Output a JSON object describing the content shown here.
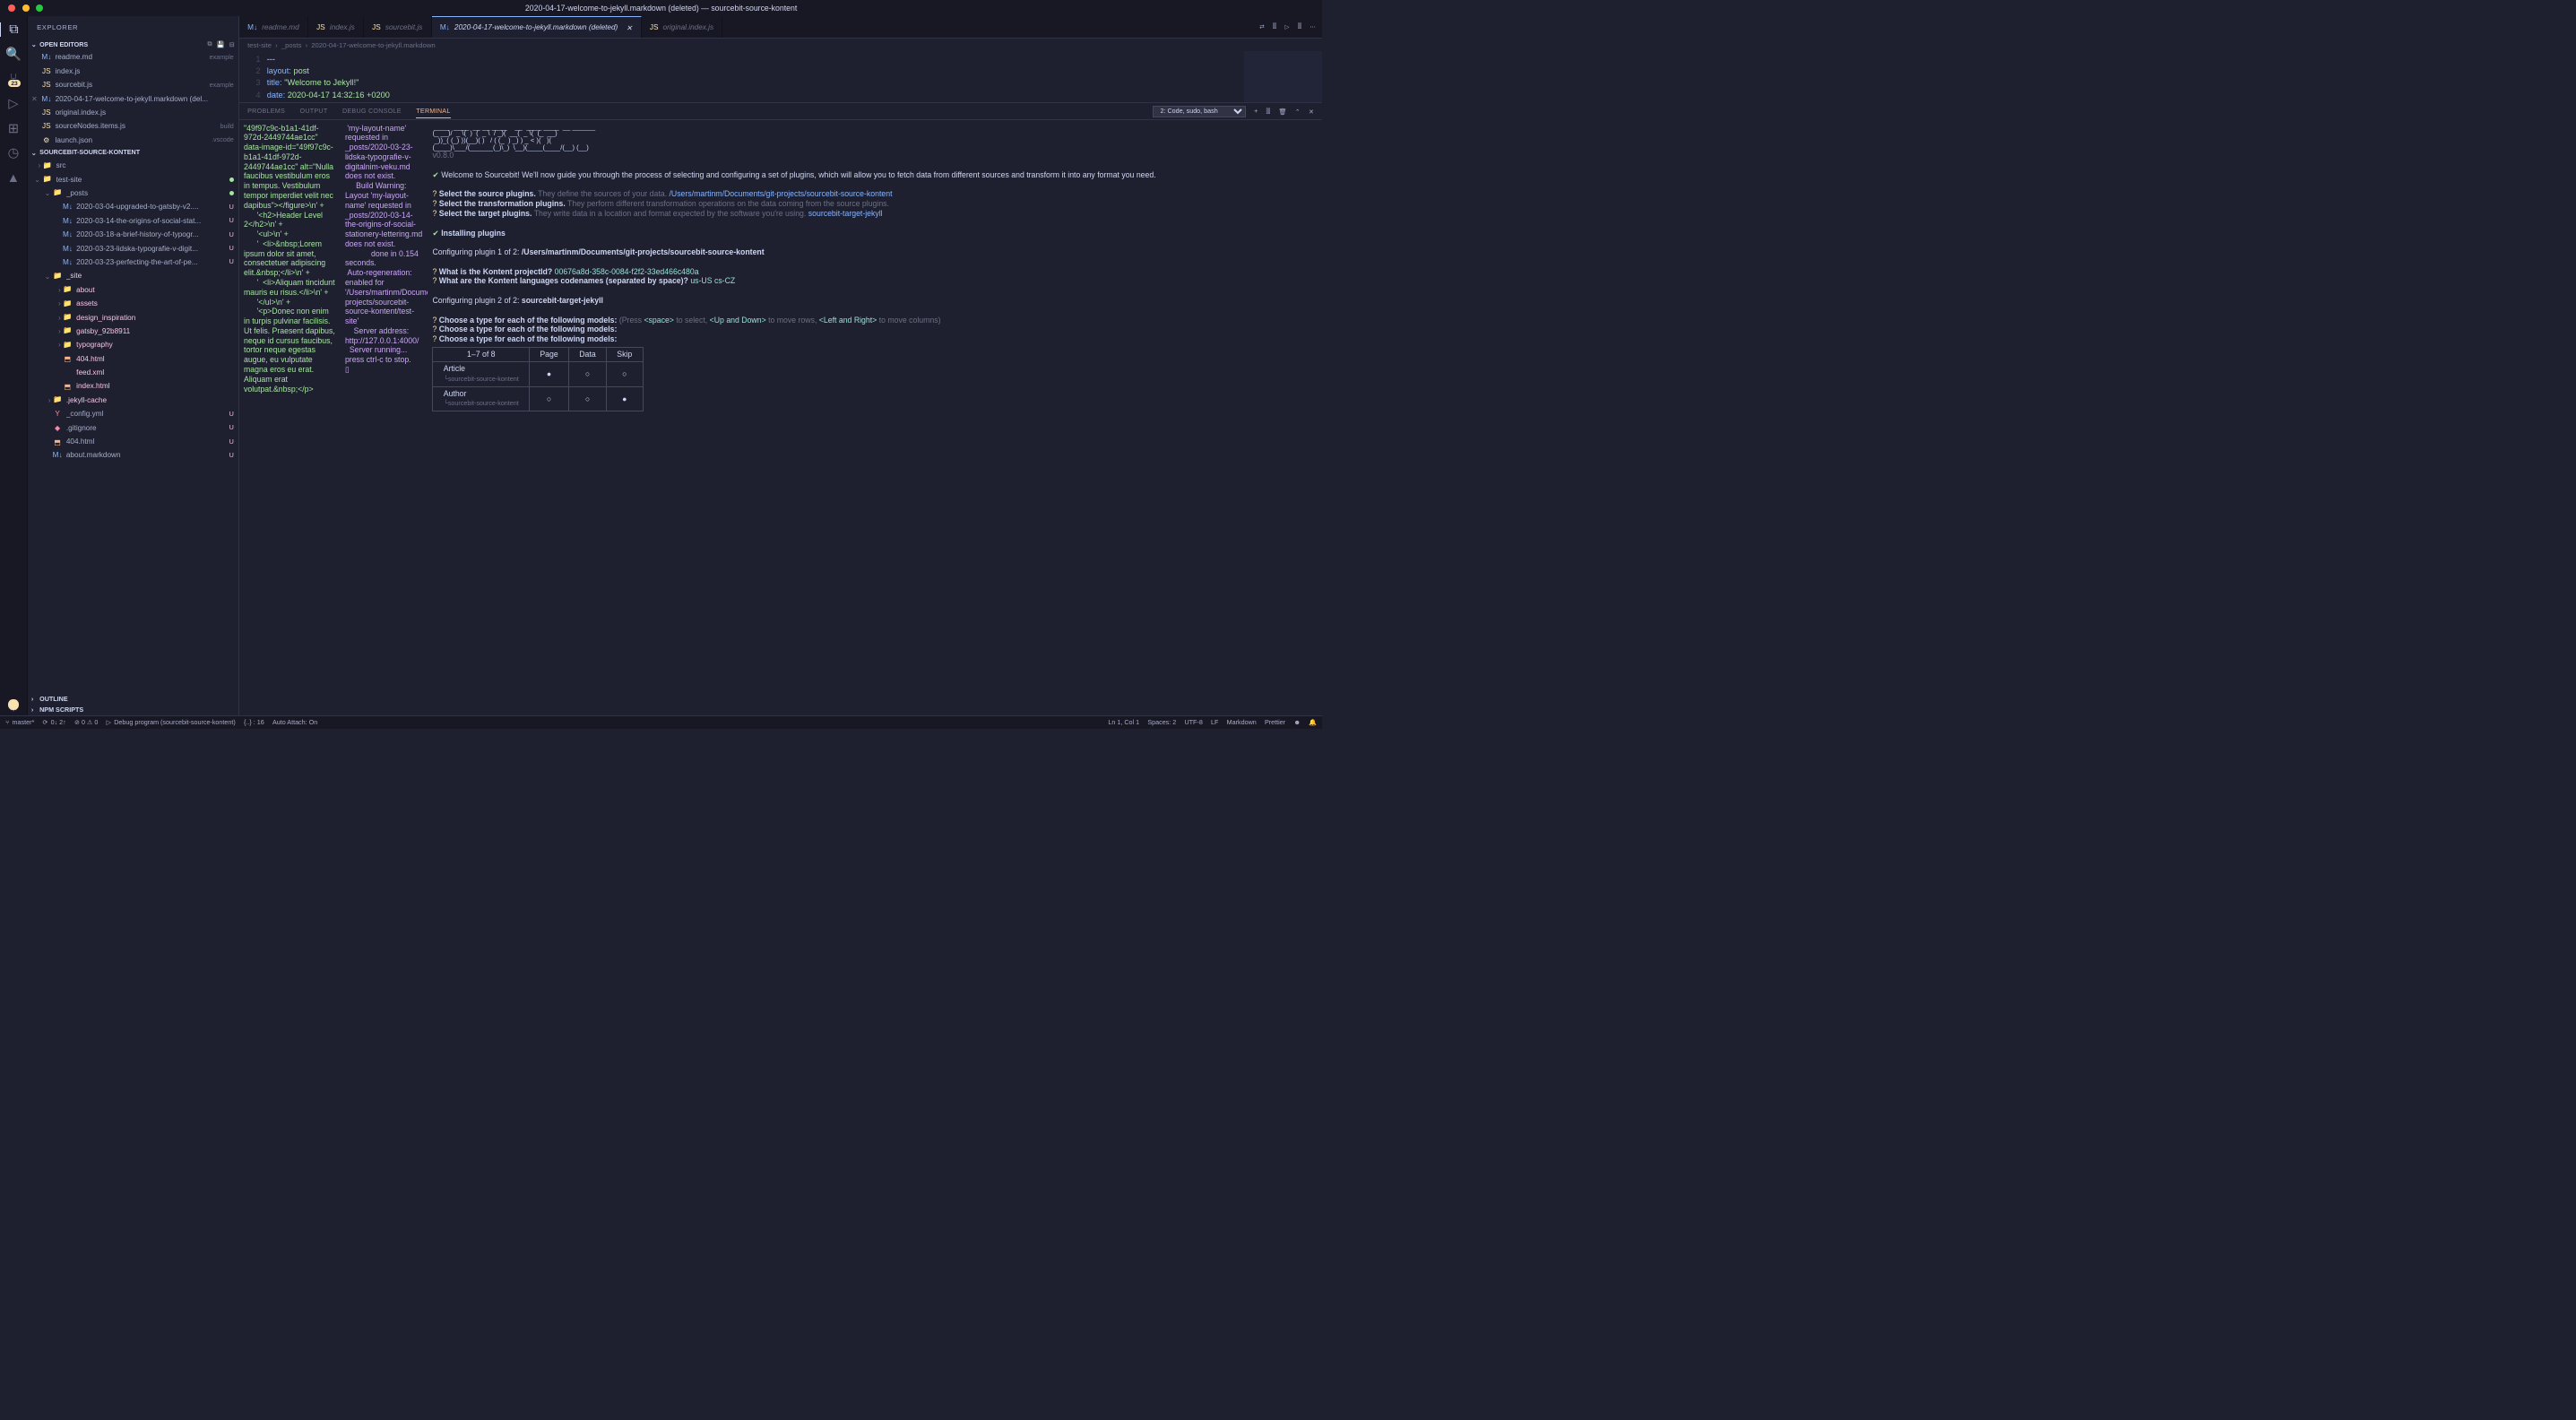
{
  "window_title": "2020-04-17-welcome-to-jekyll.markdown (deleted) — sourcebit-source-kontent",
  "explorer_label": "EXPLORER",
  "open_editors_label": "OPEN EDITORS",
  "open_editors": [
    {
      "icon": "M↓",
      "name": "readme.md",
      "desc": "example"
    },
    {
      "icon": "JS",
      "name": "index.js"
    },
    {
      "icon": "JS",
      "name": "sourcebit.js",
      "desc": "example"
    },
    {
      "icon": "M↓",
      "name": "2020-04-17-welcome-to-jekyll.markdown (del...",
      "close": true
    },
    {
      "icon": "JS",
      "name": "original.index.js"
    },
    {
      "icon": "JS",
      "name": "sourceNodes.items.js",
      "desc": "build"
    },
    {
      "icon": "⚙",
      "name": "launch.json",
      "desc": ".vscode"
    }
  ],
  "workspace_label": "SOURCEBIT-SOURCE-KONTENT",
  "tree": [
    {
      "indent": 1,
      "chev": "›",
      "ic": "📁",
      "label": "src",
      "cls": "folder"
    },
    {
      "indent": 1,
      "chev": "⌄",
      "ic": "📁",
      "label": "test-site",
      "cls": "folder",
      "dot": true
    },
    {
      "indent": 2,
      "chev": "⌄",
      "ic": "📁",
      "label": "_posts",
      "cls": "folder",
      "dot": true
    },
    {
      "indent": 3,
      "ic": "M↓",
      "label": "2020-03-04-upgraded-to-gatsby-v2....",
      "status": "U",
      "cls": "mdbadge"
    },
    {
      "indent": 3,
      "ic": "M↓",
      "label": "2020-03-14-the-origins-of-social-stat...",
      "status": "U",
      "cls": "mdbadge"
    },
    {
      "indent": 3,
      "ic": "M↓",
      "label": "2020-03-18-a-brief-history-of-typogr...",
      "status": "U",
      "cls": "mdbadge"
    },
    {
      "indent": 3,
      "ic": "M↓",
      "label": "2020-03-23-lidska-typografie-v-digit...",
      "status": "U",
      "cls": "mdbadge"
    },
    {
      "indent": 3,
      "ic": "M↓",
      "label": "2020-03-23-perfecting-the-art-of-pe...",
      "status": "U",
      "cls": "mdbadge"
    },
    {
      "indent": 2,
      "chev": "⌄",
      "ic": "📁",
      "label": "_site",
      "cls": "folder mod"
    },
    {
      "indent": 3,
      "chev": "›",
      "ic": "📁",
      "label": "about",
      "cls": "folder mod"
    },
    {
      "indent": 3,
      "chev": "›",
      "ic": "📁",
      "label": "assets",
      "cls": "folder mod"
    },
    {
      "indent": 3,
      "chev": "›",
      "ic": "📁",
      "label": "design_inspiration",
      "cls": "folder mod"
    },
    {
      "indent": 3,
      "chev": "›",
      "ic": "📁",
      "label": "gatsby_92b8911",
      "cls": "folder mod"
    },
    {
      "indent": 3,
      "chev": "›",
      "ic": "📁",
      "label": "typography",
      "cls": "folder mod"
    },
    {
      "indent": 3,
      "ic": "⬒",
      "label": "404.html",
      "cls": "html5 mod"
    },
    {
      "indent": 3,
      "ic": "</>",
      "label": "feed.xml",
      "cls": "fbadge mod"
    },
    {
      "indent": 3,
      "ic": "⬒",
      "label": "index.html",
      "cls": "html5 mod"
    },
    {
      "indent": 2,
      "chev": "›",
      "ic": "📁",
      "label": ".jekyll-cache",
      "cls": "folder mod"
    },
    {
      "indent": 2,
      "ic": "Y",
      "label": "_config.yml",
      "status": "U",
      "cls": "fbadge"
    },
    {
      "indent": 2,
      "ic": "◆",
      "label": ".gitignore",
      "status": "U",
      "cls": "fbadge"
    },
    {
      "indent": 2,
      "ic": "⬒",
      "label": "404.html",
      "status": "U",
      "cls": "html5"
    },
    {
      "indent": 2,
      "ic": "M↓",
      "label": "about.markdown",
      "status": "U",
      "cls": "mdbadge"
    }
  ],
  "outline_label": "OUTLINE",
  "npm_label": "NPM SCRIPTS",
  "tabs": [
    {
      "ic": "M↓",
      "label": "readme.md"
    },
    {
      "ic": "JS",
      "label": "index.js"
    },
    {
      "ic": "JS",
      "label": "sourcebit.js"
    },
    {
      "ic": "M↓",
      "label": "2020-04-17-welcome-to-jekyll.markdown (deleted)",
      "active": true,
      "close": true
    },
    {
      "ic": "JS",
      "label": "original.index.js"
    }
  ],
  "breadcrumb": [
    "test-site",
    "_posts",
    "2020-04-17-welcome-to-jekyll.markdown"
  ],
  "code_lines": [
    {
      "n": 1,
      "html": "<span class='p'>---</span>"
    },
    {
      "n": 2,
      "html": "<span class='k'>layout:</span> <span class='s'>post</span>"
    },
    {
      "n": 3,
      "html": "<span class='k'>title:</span>  <span class='s'>\"Welcome to Jekyll!\"</span>"
    },
    {
      "n": 4,
      "html": "<span class='k'>date:</span>   <span class='s'>2020-04-17 14:32:16 +0200</span>"
    }
  ],
  "panel_tabs": [
    "PROBLEMS",
    "OUTPUT",
    "DEBUG CONSOLE",
    "TERMINAL"
  ],
  "panel_active": "TERMINAL",
  "term_select": "2: Code, sudo, bash",
  "tcol1": "\"49f97c9c-b1a1-41df-972d-2449744ae1cc\" data-image-id=\"49f97c9c-b1a1-41df-972d-2449744ae1cc\" alt=\"Nulla faucibus vestibulum eros in tempus. Vestibulum tempor imperdiet velit nec dapibus\"></figure>\\n' +\n      '<h2>Header Level 2</h2>\\n' +\n      '<ul>\\n' +\n      '  <li>&nbsp;Lorem ipsum dolor sit amet, consectetuer adipiscing elit.&nbsp;</li>\\n' +\n      '  <li>Aliquam tincidunt mauris eu risus.</li>\\n' +\n      '</ul>\\n' +\n      '<p>Donec non enim in turpis pulvinar facilisis. Ut felis. Praesent dapibus, neque id cursus faucibus, tortor neque egestas augue, eu vulputate magna eros eu erat. Aliquam erat volutpat.&nbsp;</p>",
  "tcol2": " 'my-layout-name' requested in _posts/2020-03-23-lidska-typografie-v-digitalnim-veku.md does not exist.\n     Build Warning: Layout 'my-layout-name' requested in _posts/2020-03-14-the-origins-of-social-stationery-lettering.md does not exist.\n            done in 0.154 seconds.\n Auto-regeneration: enabled for '/Users/martinm/Documents/git-projects/sourcebit-source-kontent/test-site'\n    Server address: http://127.0.0.1:4000/\n  Server running... press ctrl-c to stop.\n▯",
  "ascii": " ____  ____  __ __ ____    __  ____ ____  __ ______\n(_ __)/  _ \\(  )  (  _ \\  / _)(  __(  _ \\(  (_  __)\n _))_( (_) ))(__)( )   / ( (_  ) _) ) _ < )(   )(\n(____)\\___/(______(_)\\_)  \\__)(____(____/(__) (__)",
  "version": "v0.8.0",
  "welcome": "Welcome to Sourcebit! We'll now guide you through the process of selecting and configuring a set of plugins, which will allow you to fetch data from different sources and transform it into any format you need.",
  "q1": "Select the source plugins.",
  "q1h": "They define the sources of your data.",
  "q1p": "/Users/martinm/Documents/git-projects/sourcebit-source-kontent",
  "q2": "Select the transformation plugins.",
  "q2h": "They perform different transformation operations on the data coming from the source plugins.",
  "q3": "Select the target plugins.",
  "q3h": "They write data in a location and format expected by the software you're using.",
  "q3p": "sourcebit-target-jekyll",
  "inst": "Installing plugins",
  "cfg1": "Configuring plugin 1 of 2:",
  "cfg1p": "/Users/martinm/Documents/git-projects/sourcebit-source-kontent",
  "qk1": "What is the Kontent projectId?",
  "qk1a": "00676a8d-358c-0084-f2f2-33ed466c480a",
  "qk2": "What are the Kontent languages codenames (separated by space)?",
  "qk2a": "us-US cs-CZ",
  "cfg2": "Configuring plugin 2 of 2:",
  "cfg2p": "sourcebit-target-jekyll",
  "qt": "Choose a type for each of the following models:",
  "qth": "(Press <space> to select, <Up and Down> to move rows, <Left and Right> to move columns)",
  "table_hdr": [
    "1–7 of 8",
    "Page",
    "Data",
    "Skip"
  ],
  "table_rows": [
    {
      "name": "Article",
      "src": "sourcebit-source-kontent",
      "sel": [
        true,
        false,
        false
      ]
    },
    {
      "name": "Author",
      "src": "sourcebit-source-kontent",
      "sel": [
        false,
        false,
        true
      ]
    }
  ],
  "status": {
    "branch": "master*",
    "sync": "0↓ 2↑",
    "err": "⊘ 0 ⚠ 0",
    "debug": "Debug program (sourcebit-source-kontent)",
    "brackets": "{..} : 16",
    "attach": "Auto Attach: On",
    "ln": "Ln 1, Col 1",
    "spaces": "Spaces: 2",
    "enc": "UTF-8",
    "eol": "LF",
    "lang": "Markdown",
    "prettier": "Prettier"
  },
  "badge": "23"
}
